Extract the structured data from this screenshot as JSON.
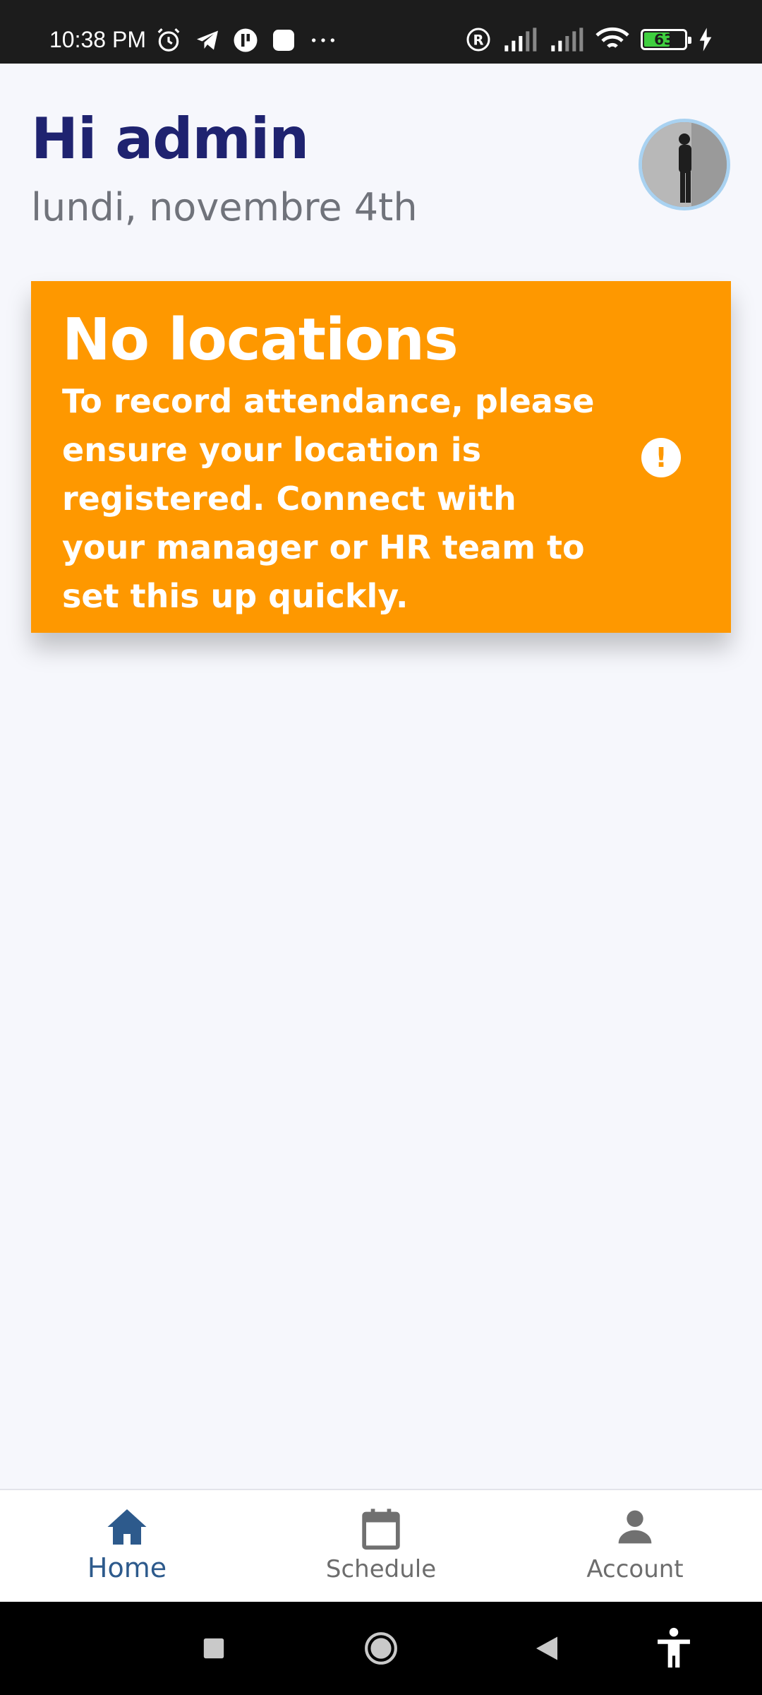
{
  "status_bar": {
    "time": "10:38 PM",
    "battery_level": "63",
    "icons": [
      "alarm-icon",
      "telegram-icon",
      "app-icon",
      "square-app-icon",
      "more-icon",
      "registered-icon",
      "signal-icon",
      "signal-icon",
      "wifi-icon",
      "battery-icon",
      "charging-icon"
    ]
  },
  "header": {
    "greeting": "Hi admin",
    "date": "lundi, novembre 4th"
  },
  "banner": {
    "title": "No locations",
    "body": "To record attendance, please ensure your location is registered. Connect with your manager or HR team to set this up quickly.",
    "icon": "exclamation-icon",
    "color": "#fe9800"
  },
  "bottom_nav": {
    "items": [
      {
        "label": "Home",
        "icon": "home-icon",
        "active": true
      },
      {
        "label": "Schedule",
        "icon": "calendar-icon",
        "active": false
      },
      {
        "label": "Account",
        "icon": "person-icon",
        "active": false
      }
    ]
  },
  "colors": {
    "primary": "#1f2370",
    "nav_active": "#2d5a8c",
    "background": "#f6f7fc"
  }
}
